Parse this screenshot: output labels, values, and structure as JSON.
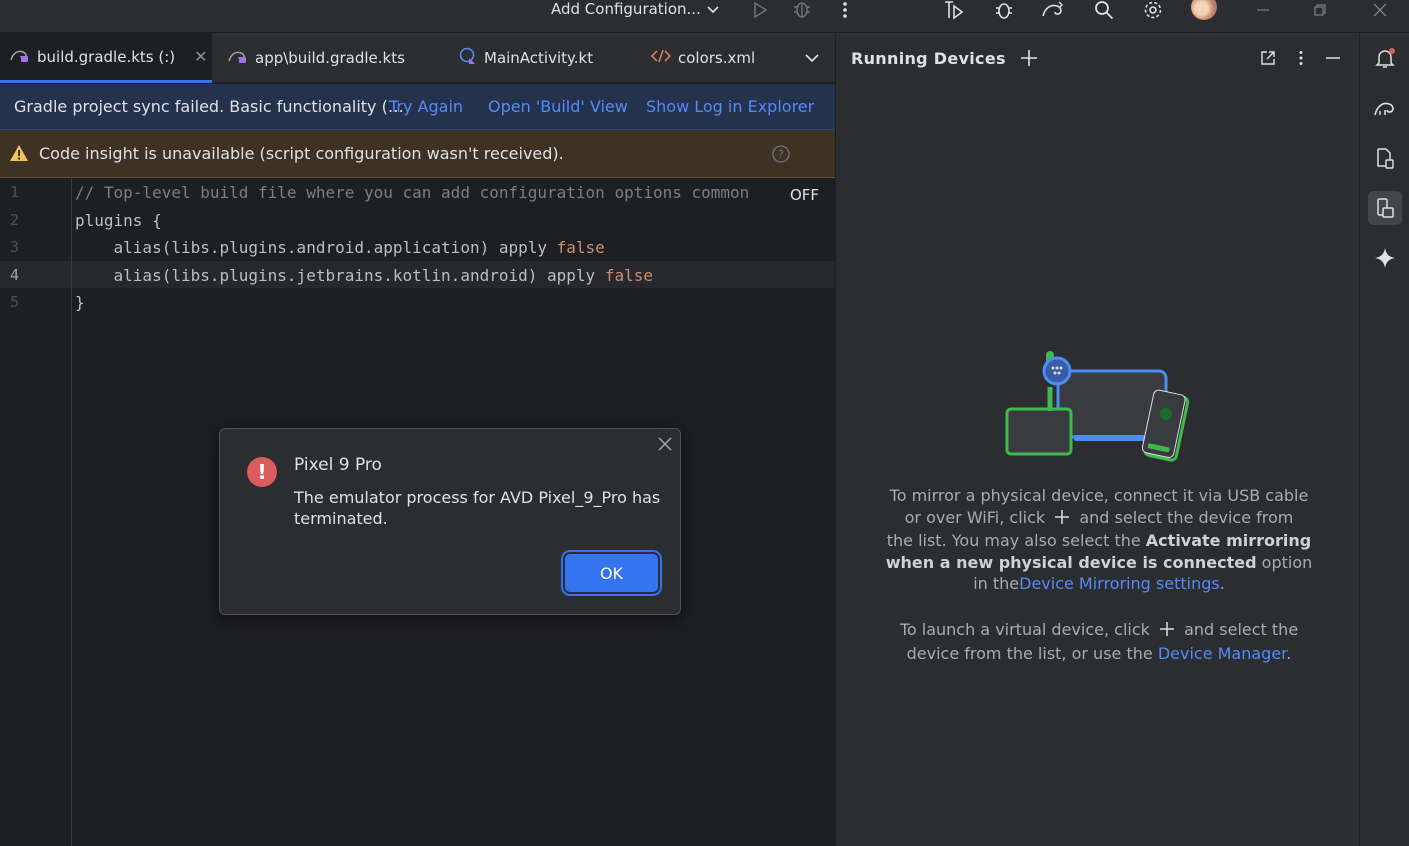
{
  "titlebar": {
    "run_config_label": "Add Configuration...",
    "icons": [
      "run-icon",
      "debug-icon",
      "more-icon",
      "profiler-icon",
      "attach-debugger-icon",
      "gradle-sync-icon",
      "search-icon",
      "settings-icon",
      "avatar",
      "minimize-icon",
      "restore-icon",
      "close-icon"
    ]
  },
  "tabs": [
    {
      "label": "build.gradle.kts (:)",
      "icon": "gradle-icon",
      "active": true
    },
    {
      "label": "app\\build.gradle.kts",
      "icon": "gradle-icon",
      "active": false
    },
    {
      "label": "MainActivity.kt",
      "icon": "kotlin-class-icon",
      "active": false
    },
    {
      "label": "colors.xml",
      "icon": "xml-icon",
      "active": false
    }
  ],
  "sync_banner": {
    "message": "Gradle project sync failed. Basic functionality (…",
    "try_again": "Try Again",
    "open_build": "Open 'Build' View",
    "show_log": "Show Log in Explorer"
  },
  "warning_banner": {
    "message": "Code insight is unavailable (script configuration wasn't received)."
  },
  "editor": {
    "line_numbers": [
      "1",
      "2",
      "3",
      "4",
      "5"
    ],
    "current_line": 4,
    "lines": [
      {
        "text": "// Top-level build file where you can add configuration options common",
        "kind": "comment"
      },
      {
        "text": "plugins {",
        "kind": "plain"
      },
      {
        "text": "    alias(libs.plugins.android.application) apply ",
        "kw": "false"
      },
      {
        "text": "    alias(libs.plugins.jetbrains.kotlin.android) apply ",
        "kw": "false"
      },
      {
        "text": "}",
        "kind": "plain"
      }
    ],
    "off_badge": "OFF"
  },
  "dialog": {
    "title": "Pixel 9 Pro",
    "message": "The emulator process for AVD Pixel_9_Pro has terminated.",
    "ok_label": "OK",
    "error_glyph": "!"
  },
  "running_devices": {
    "title": "Running Devices",
    "p1_a": "To mirror a physical device, connect it via USB cable",
    "p1_b_pre": "or over WiFi, click",
    "p1_b_post": "and select the device from",
    "p1_c_pre": "the list. You may also select the",
    "p1_c_bold": "Activate mirroring",
    "p1_d_bold": "when a new physical device is connected",
    "p1_d_post": "option",
    "p1_e_pre": "in the",
    "p1_e_link": "Device Mirroring settings",
    "p1_e_post": ".",
    "p2_a_pre": "To launch a virtual device, click",
    "p2_a_post": "and select the",
    "p2_b_pre": "device from the list, or use the",
    "p2_b_link": "Device Manager",
    "p2_b_post": "."
  },
  "colors": {
    "accent": "#3574f0",
    "link": "#548af7",
    "error": "#db5c5c",
    "warning": "#f2c55c",
    "keyword": "#cf8e6d",
    "device_green": "#3fb950",
    "device_blue": "#4c8df6"
  }
}
